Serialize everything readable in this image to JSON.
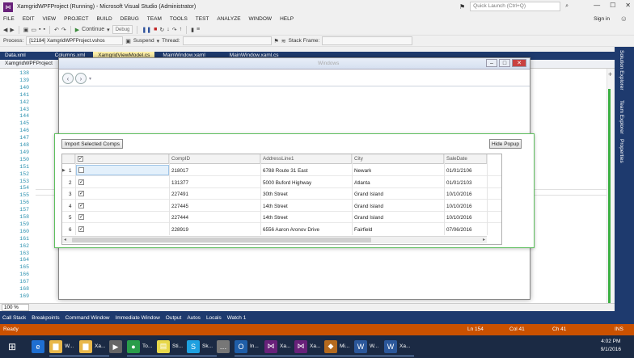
{
  "titlebar": {
    "title": "XamgridWPFProject (Running) - Microsoft Visual Studio (Administrator)",
    "quick_launch_placeholder": "Quick Launch (Ctrl+Q)",
    "minimize": "—",
    "maximize": "☐",
    "close": "✕"
  },
  "menu": {
    "items": [
      "FILE",
      "EDIT",
      "VIEW",
      "PROJECT",
      "BUILD",
      "DEBUG",
      "TEAM",
      "TOOLS",
      "TEST",
      "ANALYZE",
      "WINDOW",
      "HELP"
    ],
    "signin": "Sign in"
  },
  "toolbar1": {
    "continue_label": "Continue",
    "config_value": "Debug"
  },
  "toolbar2": {
    "process_label": "Process:",
    "process_value": "[12184] XamgridWPFProject.vshos",
    "suspend_label": "Suspend",
    "thread_label": "Thread:",
    "stack_label": "Stack Frame:"
  },
  "doctabs": [
    {
      "label": "Data.xml",
      "active": false
    },
    {
      "label": "Columns.xml",
      "active": false
    },
    {
      "label": "XamgridViewModel.cs",
      "active": true
    },
    {
      "label": "MainWindow.xaml",
      "active": false
    },
    {
      "label": "MainWindow.xaml.cs",
      "active": false
    }
  ],
  "subtab_label": "XamgridWPFProject",
  "editor": {
    "line_numbers": [
      "138",
      "139",
      "140",
      "141",
      "142",
      "143",
      "144",
      "145",
      "146",
      "147",
      "148",
      "149",
      "150",
      "151",
      "152",
      "153",
      "154",
      "155",
      "156",
      "157",
      "158",
      "159",
      "160",
      "161",
      "162",
      "163",
      "164",
      "165",
      "166",
      "167",
      "168",
      "169"
    ],
    "zoom": "100 %"
  },
  "sidetabs": [
    "Solution Explorer",
    "Team Explorer",
    "Properties"
  ],
  "app_window": {
    "title": "",
    "caption": "Windows"
  },
  "popup": {
    "import_button": "Import Selected Comps",
    "hide_button": "Hide Popup",
    "grid": {
      "columns": [
        "CompID",
        "AddressLine1",
        "City",
        "SaleDate"
      ],
      "rows": [
        {
          "num": "1",
          "checked": false,
          "compid": "218017",
          "address": "6788 Route 31 East",
          "city": "Newark",
          "date": "01/01/2106"
        },
        {
          "num": "2",
          "checked": true,
          "compid": "131377",
          "address": "5000 Buford Highway",
          "city": "Atlanta",
          "date": "01/01/2103"
        },
        {
          "num": "3",
          "checked": true,
          "compid": "227491",
          "address": "30th Street",
          "city": "Grand Island",
          "date": "10/10/2016"
        },
        {
          "num": "4",
          "checked": true,
          "compid": "227445",
          "address": "14th Street",
          "city": "Grand Island",
          "date": "10/10/2016"
        },
        {
          "num": "5",
          "checked": true,
          "compid": "227444",
          "address": "14th Street",
          "city": "Grand Island",
          "date": "10/10/2016"
        },
        {
          "num": "6",
          "checked": true,
          "compid": "228919",
          "address": "6556 Aaron Aronov Drive",
          "city": "Fairfield",
          "date": "07/06/2016"
        }
      ]
    }
  },
  "bottomtabs": [
    "Call Stack",
    "Breakpoints",
    "Command Window",
    "Immediate Window",
    "Output",
    "Autos",
    "Locals",
    "Watch 1"
  ],
  "status": {
    "ready": "Ready",
    "ln": "Ln 154",
    "col": "Col 41",
    "ch": "Ch 41",
    "ins": "INS"
  },
  "taskbar": {
    "items": [
      {
        "icon": "edge-icon",
        "glyph": "e",
        "label": "",
        "color": "#1f6fd1"
      },
      {
        "icon": "folder-icon",
        "glyph": "▆",
        "label": "W...",
        "color": "#e9b84a"
      },
      {
        "icon": "folder-icon",
        "glyph": "▆",
        "label": "Xa...",
        "color": "#e9b84a"
      },
      {
        "icon": "media-icon",
        "glyph": "▶",
        "label": "",
        "color": "#666"
      },
      {
        "icon": "chrome-icon",
        "glyph": "●",
        "label": "To...",
        "color": "#2a9d4a"
      },
      {
        "icon": "sticky-icon",
        "glyph": "▤",
        "label": "Sti...",
        "color": "#e8d84a"
      },
      {
        "icon": "skype-icon",
        "glyph": "S",
        "label": "Sk...",
        "color": "#1ea0e0"
      },
      {
        "icon": "chat-icon",
        "glyph": "…",
        "label": "",
        "color": "#777"
      },
      {
        "icon": "outlook-icon",
        "glyph": "O",
        "label": "In...",
        "color": "#1f5ea8"
      },
      {
        "icon": "vs-icon",
        "glyph": "⋈",
        "label": "Xa...",
        "color": "#68217a"
      },
      {
        "icon": "vs-icon",
        "glyph": "⋈",
        "label": "Xa...",
        "color": "#68217a"
      },
      {
        "icon": "app-icon",
        "glyph": "◆",
        "label": "Mi...",
        "color": "#b46a1e"
      },
      {
        "icon": "word-icon",
        "glyph": "W",
        "label": "W...",
        "color": "#2b579a"
      },
      {
        "icon": "word-icon",
        "glyph": "W",
        "label": "Xa...",
        "color": "#2b579a"
      }
    ],
    "time": "4:02 PM",
    "date": "9/1/2016"
  }
}
